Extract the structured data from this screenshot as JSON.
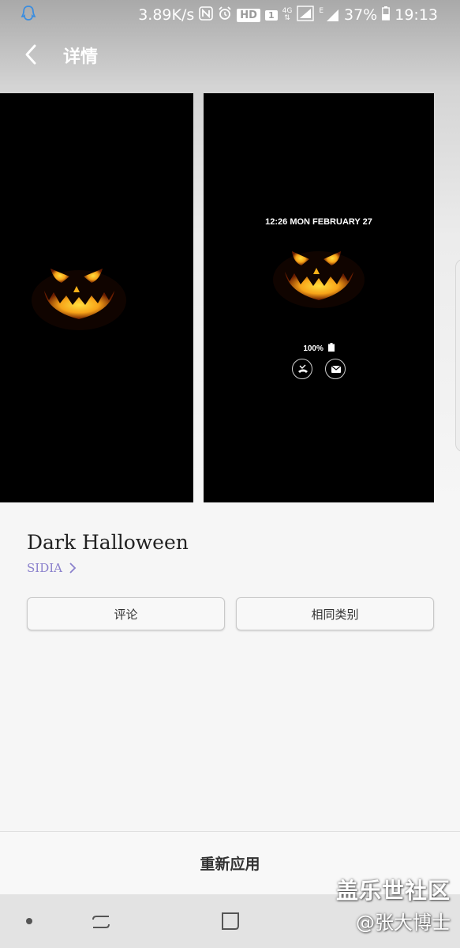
{
  "status_bar": {
    "speed": "3.89K/s",
    "hd": "HD",
    "sim": "1",
    "net_4g": "4G",
    "net_e": "E",
    "battery": "37%",
    "time": "19:13"
  },
  "header": {
    "title": "详情"
  },
  "preview_aod": {
    "datetime": "12:26  MON FEBRUARY 27",
    "battery": "100%"
  },
  "wallpaper": {
    "name": "Dark Halloween",
    "publisher": "SIDIA"
  },
  "actions": {
    "review": "评论",
    "similar": "相同类别",
    "apply": "重新应用"
  },
  "watermark": {
    "main": "盖乐世社区",
    "sub": "@张大博士"
  },
  "colors": {
    "publisher_link": "#8a80cc",
    "pumpkin_glow": "#f7c21b",
    "pumpkin_dark": "#c44a00"
  }
}
